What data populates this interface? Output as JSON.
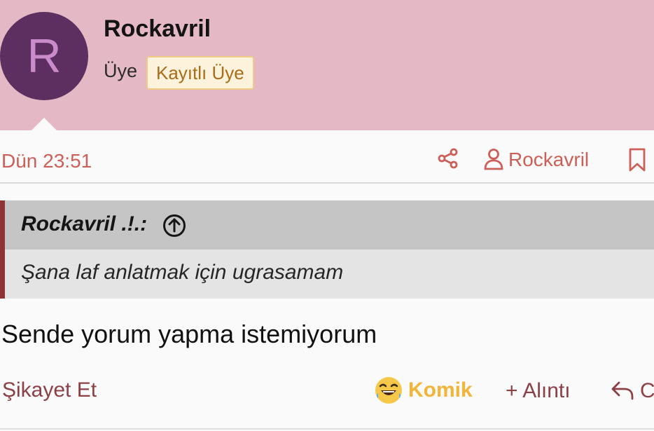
{
  "profile": {
    "avatar_letter": "R",
    "name": "Rockavril",
    "role": "Üye",
    "badge": "Kayıtlı Üye"
  },
  "post_meta": {
    "time": "Dün 23:51",
    "user_link": "Rockavril",
    "icons": [
      "share-icon",
      "user-icon",
      "bookmark-icon"
    ]
  },
  "quote": {
    "author": "Rockavril .!.:",
    "text": "Şana laf anlatmak için ugrasamam",
    "icon": "arrow-up-circle-icon"
  },
  "post": {
    "content": "Sende yorum yapma istemiyorum"
  },
  "actions": {
    "report": "Şikayet Et",
    "reaction": "Komik",
    "quote": "+ Alıntı",
    "reply": "C"
  },
  "colors": {
    "header_bg": "#e5b8c5",
    "avatar_bg": "#5d2f61",
    "accent": "#cc5f58",
    "action": "#8c4046",
    "reaction": "#f0b53a"
  }
}
